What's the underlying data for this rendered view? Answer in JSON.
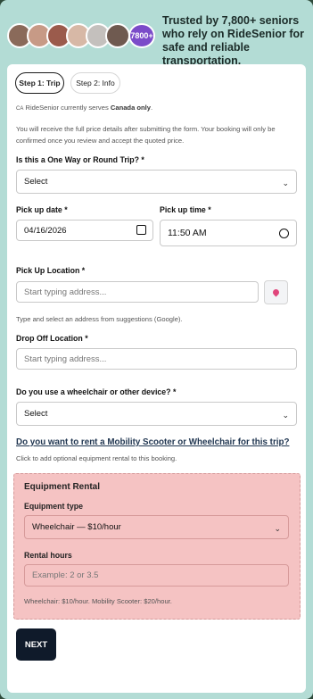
{
  "header": {
    "avatar_count": "7800+",
    "tagline": "Trusted by 7,800+ seniors who rely on RideSenior for safe and reliable transportation."
  },
  "tabs": [
    {
      "label": "Step 1: Trip"
    },
    {
      "label": "Step 2: Info"
    }
  ],
  "notice": {
    "flag": "CA",
    "prefix": "RideSenior currently serves ",
    "country": "Canada only",
    "suffix": "."
  },
  "price_note": "You will receive the full price details after submitting the form. Your booking will only be confirmed once you review and accept the quoted price.",
  "form": {
    "trip_type": {
      "label": "Is this a One Way or Round Trip? *",
      "value": "Select"
    },
    "pickup_date": {
      "label": "Pick up date *",
      "value": "04/16/2026"
    },
    "pickup_time": {
      "label": "Pick up time *",
      "value": "11:50 AM"
    },
    "pickup_location": {
      "label": "Pick Up Location *",
      "placeholder": "Start typing address...",
      "hint": "Type and select an address from suggestions (Google)."
    },
    "dropoff_location": {
      "label": "Drop Off Location *",
      "placeholder": "Start typing address..."
    },
    "device": {
      "label": "Do you use a wheelchair or other device? *",
      "value": "Select"
    }
  },
  "rental_link": {
    "label": "Do you want to rent a Mobility Scooter or Wheelchair for this trip?",
    "hint": "Click to add optional equipment rental to this booking."
  },
  "equipment_rental": {
    "title": "Equipment Rental",
    "type_label": "Equipment type",
    "type_value": "Wheelchair — $10/hour",
    "hours_label": "Rental hours",
    "hours_placeholder": "Example: 2 or 3.5",
    "pricing_note": "Wheelchair: $10/hour. Mobility Scooter: $20/hour."
  },
  "next_button": "NEXT",
  "colors": {
    "frame": "#b3dcd5",
    "accent": "#7b4bc9",
    "rental_bg": "#f5c3c3",
    "button": "#0f1a2a"
  }
}
